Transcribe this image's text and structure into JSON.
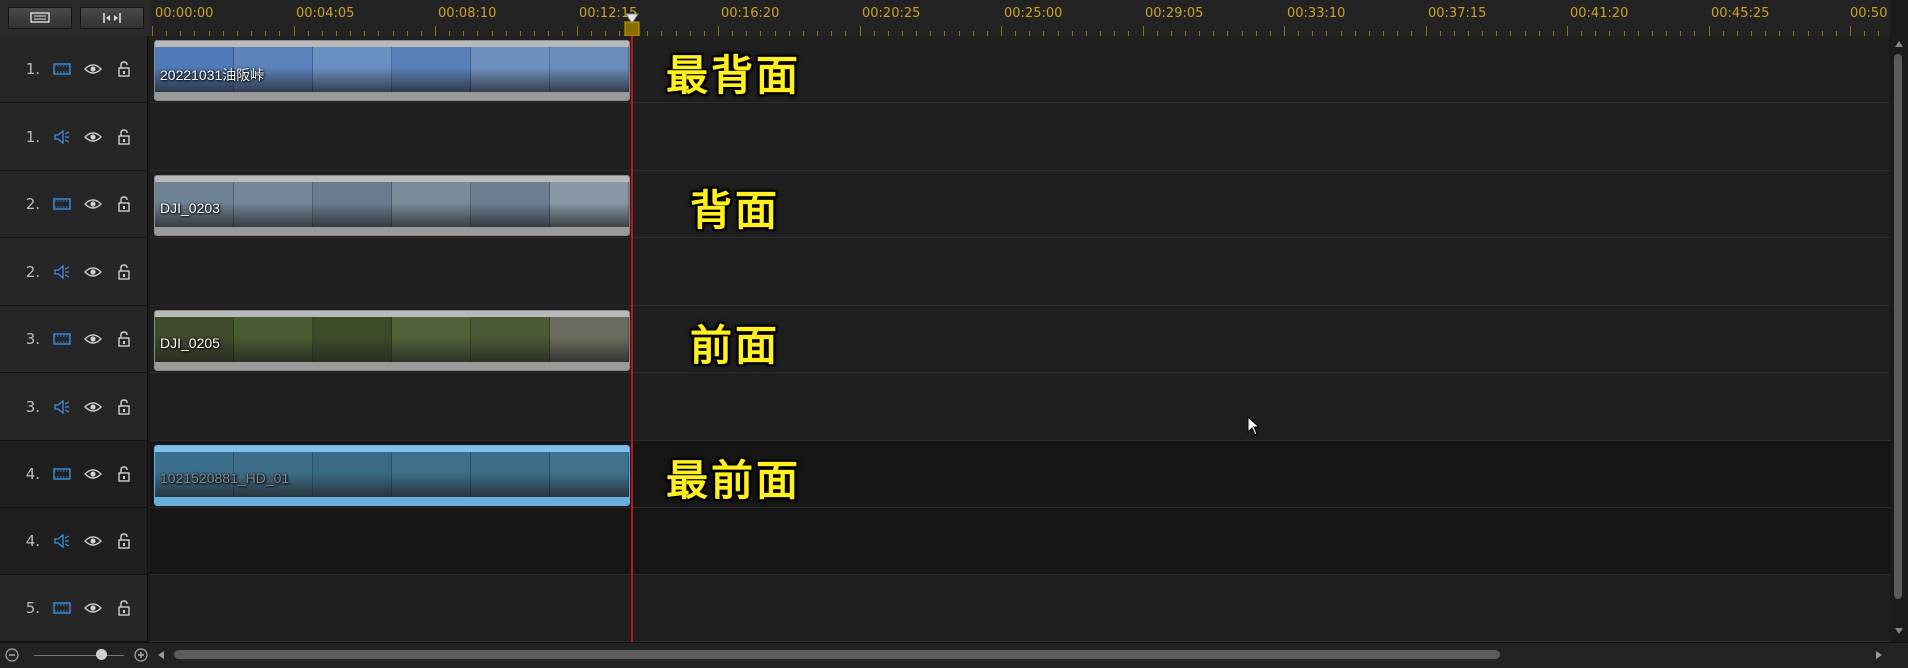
{
  "toolbar": {
    "left_button_icon": "track-manager-icon",
    "right_button_icon": "fit-timeline-icon"
  },
  "ruler": {
    "labels": [
      "00:00:00",
      "00:04:05",
      "00:08:10",
      "00:12:15",
      "00:16:20",
      "00:20:25",
      "00:25:00",
      "00:29:05",
      "00:33:10",
      "00:37:15",
      "00:41:20",
      "00:45:25",
      "00:50"
    ]
  },
  "tracks": [
    {
      "num": "1.",
      "kind": "video"
    },
    {
      "num": "1.",
      "kind": "audio"
    },
    {
      "num": "2.",
      "kind": "video"
    },
    {
      "num": "2.",
      "kind": "audio"
    },
    {
      "num": "3.",
      "kind": "video"
    },
    {
      "num": "3.",
      "kind": "audio"
    },
    {
      "num": "4.",
      "kind": "video"
    },
    {
      "num": "4.",
      "kind": "audio"
    },
    {
      "num": "5.",
      "kind": "video"
    }
  ],
  "clips": [
    {
      "name": "20221031油阪峠",
      "label": "最背面",
      "palette": [
        "#4f79b8",
        "#5d83bd",
        "#6a8fc2",
        "#5a80b9",
        "#6e90c0",
        "#6b8dbd"
      ]
    },
    {
      "name": "DJI_0203",
      "label": "背面",
      "palette": [
        "#6f8194",
        "#74879a",
        "#6a7d90",
        "#7a8c9c",
        "#6d8093",
        "#8898a6"
      ]
    },
    {
      "name": "DJI_0205",
      "label": "前面",
      "palette": [
        "#3e4a2a",
        "#4a5a33",
        "#3d4b28",
        "#52613a",
        "#4b5835",
        "#6c6a5e"
      ]
    },
    {
      "name": "1021520881_HD_01",
      "label": "最前面",
      "palette": [
        "#3b6f8c",
        "#3d6d89",
        "#3a6a86",
        "#3e6f8b",
        "#3c6c88",
        "#40718d"
      ]
    }
  ],
  "colors": {
    "ruler_text": "#c9a227",
    "playhead": "#c0141c",
    "label_yellow": "#fff01e",
    "icon_blue": "#3a8fe0"
  }
}
